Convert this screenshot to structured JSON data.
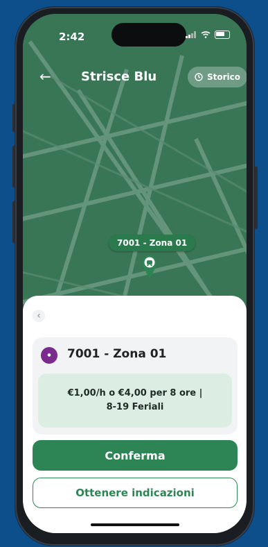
{
  "status": {
    "time": "2:42"
  },
  "header": {
    "title": "Strisce Blu",
    "history_label": "Storico"
  },
  "map": {
    "zone_label": "7001 - Zona 01"
  },
  "sheet": {
    "zone_name": "7001 - Zona 01",
    "tariff_line1": "€1,00/h o €4,00 per 8 ore |",
    "tariff_line2": "8-19 Feriali",
    "confirm_label": "Conferma",
    "directions_label": "Ottenere indicazioni"
  },
  "colors": {
    "background": "#0d4f8a",
    "map_green": "#3b7a5a",
    "primary": "#2d8555",
    "tariff_bg": "#dceee3"
  },
  "icons": {
    "back": "arrow-left-icon",
    "history": "clock-icon",
    "pin": "parking-pin-icon",
    "sheet_back": "chevron-left-icon"
  }
}
